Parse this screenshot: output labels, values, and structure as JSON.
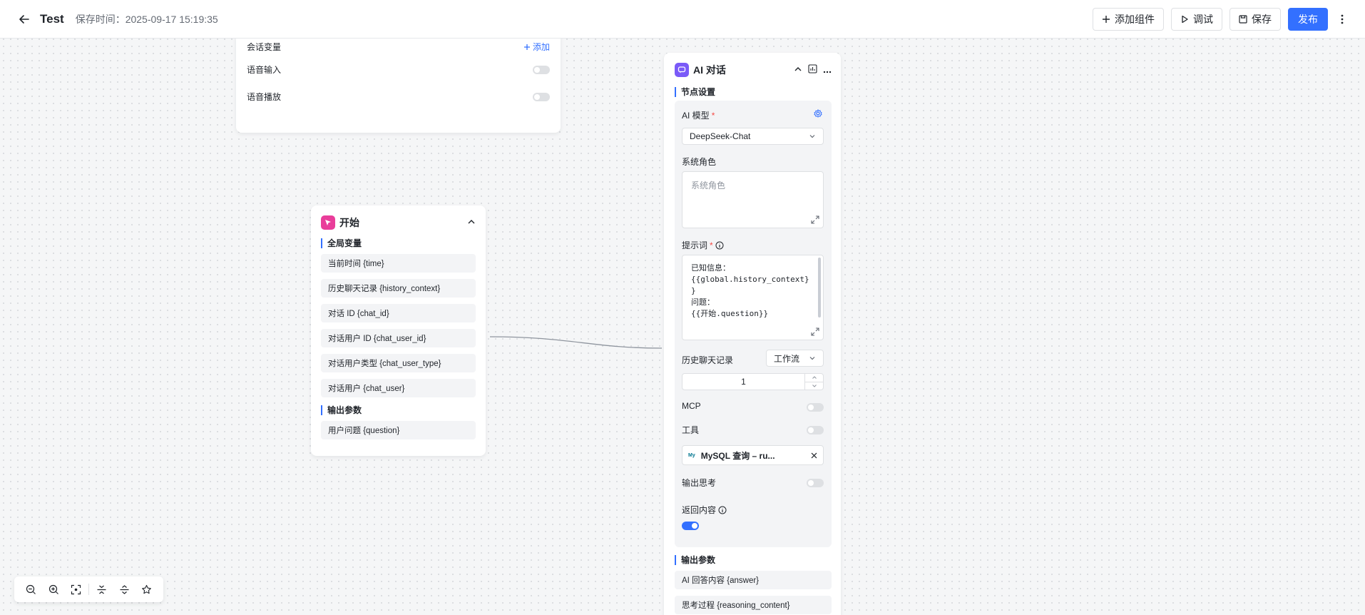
{
  "header": {
    "title": "Test",
    "save_time_label": "保存时间：",
    "save_time": "2025-09-17 15:19:35",
    "add_component": "添加组件",
    "debug": "调试",
    "save": "保存",
    "publish": "发布"
  },
  "colors": {
    "accent": "#3370ff",
    "start_icon": "#e93d9a",
    "ai_icon": "#7a5af8"
  },
  "conversation_card": {
    "variables_label": "会话变量",
    "add_label": "添加",
    "voice_input": "语音输入",
    "voice_input_on": false,
    "voice_playback": "语音播放",
    "voice_playback_on": false
  },
  "start_node": {
    "title": "开始",
    "global_vars_title": "全局变量",
    "global_vars": [
      "当前时间 {time}",
      "历史聊天记录 {history_context}",
      "对话 ID {chat_id}",
      "对话用户 ID {chat_user_id}",
      "对话用户类型 {chat_user_type}",
      "对话用户 {chat_user}"
    ],
    "output_title": "输出参数",
    "outputs": [
      "用户问题 {question}"
    ]
  },
  "ai_node": {
    "title": "AI 对话",
    "settings_title": "节点设置",
    "model_label": "AI 模型",
    "model_value": "DeepSeek-Chat",
    "system_role_label": "系统角色",
    "system_role_placeholder": "系统角色",
    "prompt_label": "提示词",
    "prompt_value": "已知信息：\n{{global.history_context}\n}\n问题：\n{{开始.question}}",
    "history_label": "历史聊天记录",
    "history_source": "工作流",
    "history_count": "1",
    "mcp_label": "MCP",
    "mcp_on": false,
    "tools_label": "工具",
    "tools_on": false,
    "tool_name": "MySQL 查询 – ru...",
    "output_thinking_label": "输出思考",
    "output_thinking_on": false,
    "return_content_label": "返回内容",
    "return_content_on": true,
    "output_title": "输出参数",
    "outputs": [
      "AI 回答内容 {answer}",
      "思考过程 {reasoning_content}"
    ]
  }
}
